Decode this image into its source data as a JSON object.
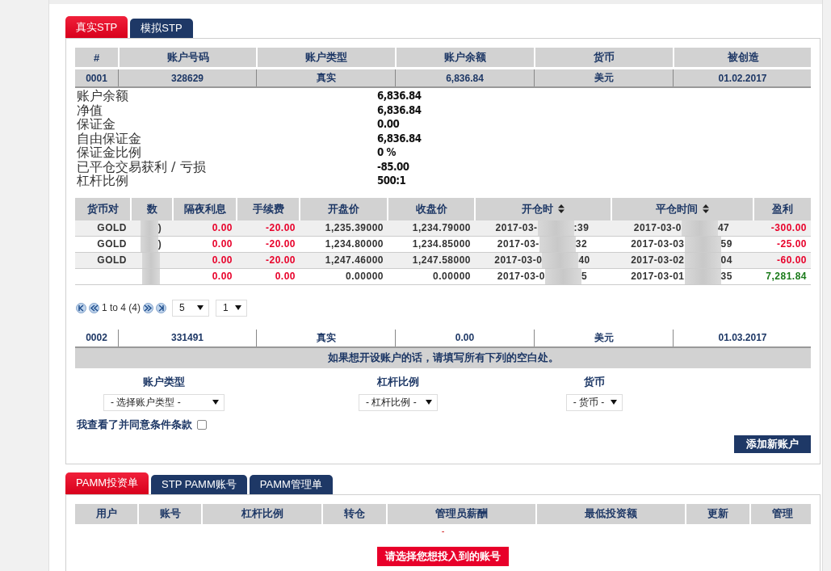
{
  "account_tabs": [
    {
      "label": "真实STP",
      "selected": true
    },
    {
      "label": "模拟STP",
      "selected": false
    }
  ],
  "accounts_table": {
    "columns": [
      "#",
      "账户号码",
      "账户类型",
      "账户余额",
      "货币",
      "被创造"
    ],
    "rows": [
      {
        "cells": [
          "0001",
          "328629",
          "真实",
          "6,836.84",
          "美元",
          "01.02.2017"
        ],
        "expanded": true
      },
      {
        "cells": [
          "0002",
          "331491",
          "真实",
          "0.00",
          "美元",
          "01.03.2017"
        ],
        "expanded": false
      }
    ]
  },
  "summary": [
    {
      "label": "账户余额",
      "value": "6,836.84"
    },
    {
      "label": "净值",
      "value": "6,836.84"
    },
    {
      "label": "保证金",
      "value": "0.00"
    },
    {
      "label": "自由保证金",
      "value": "6,836.84"
    },
    {
      "label": "保证金比例",
      "value": "0 %"
    },
    {
      "label": "已平仓交易获利 / 亏损",
      "value": "-85.00"
    },
    {
      "label": "杠杆比例",
      "value": "500:1"
    }
  ],
  "trades_table": {
    "columns": [
      {
        "label": "货币对",
        "sortable": false
      },
      {
        "label": "数",
        "sortable": false
      },
      {
        "label": "隔夜利息",
        "sortable": false
      },
      {
        "label": "手续费",
        "sortable": false
      },
      {
        "label": "开盘价",
        "sortable": false
      },
      {
        "label": "收盘价",
        "sortable": false
      },
      {
        "label": "开仓时",
        "sortable": true
      },
      {
        "label": "平仓时间",
        "sortable": true
      },
      {
        "label": "盈利",
        "sortable": false
      }
    ],
    "rows": [
      {
        "symbol": "GOLD",
        "volume": ")",
        "swap": "0.00",
        "commission": "-20.00",
        "open_price": "1,235.39000",
        "close_price": "1,234.79000",
        "open_time": [
          "2017-03-",
          ":39"
        ],
        "close_time": [
          "2017-03-0",
          "47"
        ],
        "profit": "-300.00"
      },
      {
        "symbol": "GOLD",
        "volume": ")",
        "swap": "0.00",
        "commission": "-20.00",
        "open_price": "1,234.80000",
        "close_price": "1,234.85000",
        "open_time": [
          "2017-03-",
          "32"
        ],
        "close_time": [
          "2017-03-03",
          "59"
        ],
        "profit": "-25.00"
      },
      {
        "symbol": "GOLD",
        "volume": "",
        "swap": "0.00",
        "commission": "-20.00",
        "open_price": "1,247.46000",
        "close_price": "1,247.58000",
        "open_time": [
          "2017-03-0",
          "40"
        ],
        "close_time": [
          "2017-03-02",
          "04"
        ],
        "profit": "-60.00"
      },
      {
        "symbol": "",
        "volume": "",
        "swap": "0.00",
        "commission": "0.00",
        "open_price": "0.00000",
        "close_price": "0.00000",
        "open_time": [
          "2017-03-0",
          "5"
        ],
        "close_time": [
          "2017-03-01",
          "35"
        ],
        "profit": "7,281.84"
      }
    ]
  },
  "pager": {
    "info": "1 to 4 (4)",
    "page_size": "5",
    "page": "1"
  },
  "new_account": {
    "notice": "如果想开设账户的话，请填写所有下列的空白处。",
    "fields": [
      {
        "label": "账户类型",
        "value": "- 选择账户类型 -"
      },
      {
        "label": "杠杆比例",
        "value": "- 杠杆比例 -"
      },
      {
        "label": "货币",
        "value": "- 货币 -"
      }
    ],
    "terms": {
      "label": "我查看了并同意条件条款",
      "checked": false
    },
    "button": "添加新账户"
  },
  "pamm_tabs": [
    {
      "label": "PAMM投资单",
      "selected": true
    },
    {
      "label": "STP PAMM账号",
      "selected": false
    },
    {
      "label": "PAMM管理单",
      "selected": false
    }
  ],
  "pamm_table": {
    "columns": [
      "用户",
      "账号",
      "杠杆比例",
      "转仓",
      "管理员薪酬",
      "最低投资额",
      "更新",
      "管理"
    ],
    "empty_mark": "-",
    "message": "请选择您想投入到的账号"
  }
}
